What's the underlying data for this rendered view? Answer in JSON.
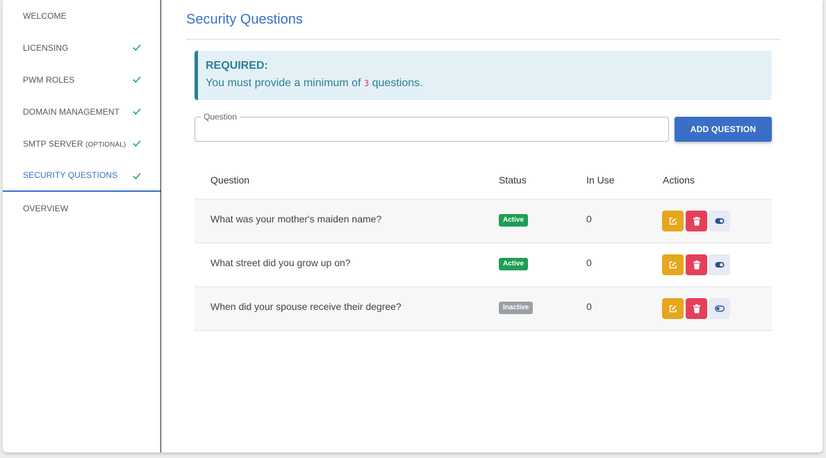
{
  "sidebar": {
    "items": [
      {
        "label": "WELCOME",
        "suffix": "",
        "checked": false
      },
      {
        "label": "LICENSING",
        "suffix": "",
        "checked": true
      },
      {
        "label": "PWM ROLES",
        "suffix": "",
        "checked": true
      },
      {
        "label": "DOMAIN MANAGEMENT",
        "suffix": "",
        "checked": true
      },
      {
        "label": "SMTP SERVER",
        "suffix": "(OPTIONAL)",
        "checked": true
      },
      {
        "label": "SECURITY QUESTIONS",
        "suffix": "",
        "checked": true,
        "active": true
      },
      {
        "label": "OVERVIEW",
        "suffix": "",
        "checked": false
      }
    ]
  },
  "main": {
    "title": "Security Questions",
    "alert": {
      "title": "REQUIRED:",
      "text_before": "You must provide a minimum of",
      "min_count": "3",
      "text_after": "questions."
    },
    "question_field": {
      "legend": "Question",
      "value": ""
    },
    "add_button": "ADD QUESTION",
    "table": {
      "headers": {
        "question": "Question",
        "status": "Status",
        "in_use": "In Use",
        "actions": "Actions"
      },
      "rows": [
        {
          "question": "What was your mother's maiden name?",
          "status": "Active",
          "in_use": "0"
        },
        {
          "question": "What street did you grow up on?",
          "status": "Active",
          "in_use": "0"
        },
        {
          "question": "When did your spouse receive their degree?",
          "status": "Inactive",
          "in_use": "0"
        }
      ]
    }
  },
  "colors": {
    "accent": "#3a6fc7",
    "success": "#1f9d55",
    "inactive": "#9aa0a6",
    "edit": "#e5a71c",
    "delete": "#e4405b",
    "alert_text": "#2f7e96",
    "alert_bg": "#e3f1f7"
  },
  "icons": {
    "check": "check-icon",
    "edit": "edit-icon",
    "delete": "trash-icon",
    "toggle": "toggle-icon"
  }
}
